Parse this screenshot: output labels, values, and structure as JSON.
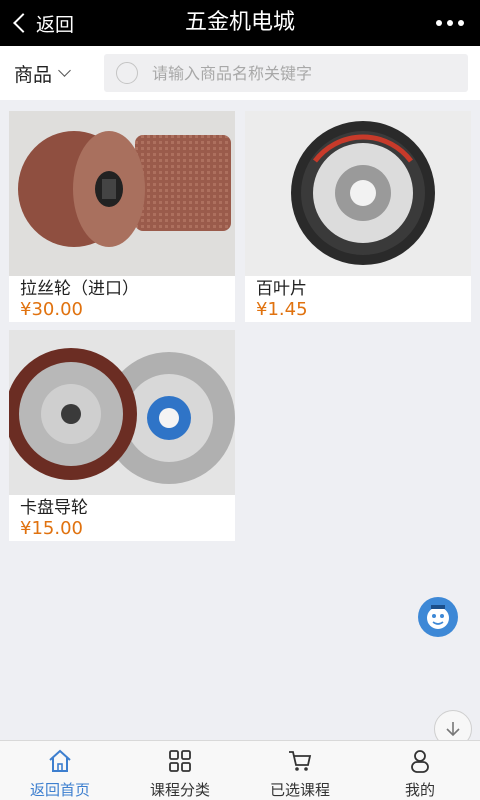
{
  "header": {
    "back_label": "返回",
    "title": "五金机电城"
  },
  "search": {
    "category": "商品",
    "placeholder": "请输入商品名称关键字"
  },
  "products": [
    {
      "name": "拉丝轮（进口）",
      "price": "¥30.00"
    },
    {
      "name": "百叶片",
      "price": "¥1.45"
    },
    {
      "name": "卡盘导轮",
      "price": "¥15.00"
    }
  ],
  "tabbar": {
    "tabs": [
      {
        "label": "返回首页",
        "icon": "home-icon",
        "active": true
      },
      {
        "label": "课程分类",
        "icon": "grid-icon",
        "active": false
      },
      {
        "label": "已选课程",
        "icon": "cart-icon",
        "active": false
      },
      {
        "label": "我的",
        "icon": "user-icon",
        "active": false
      }
    ]
  },
  "colors": {
    "price": "#e0720f",
    "accent": "#3d7fcf",
    "header_bg": "#000000"
  }
}
